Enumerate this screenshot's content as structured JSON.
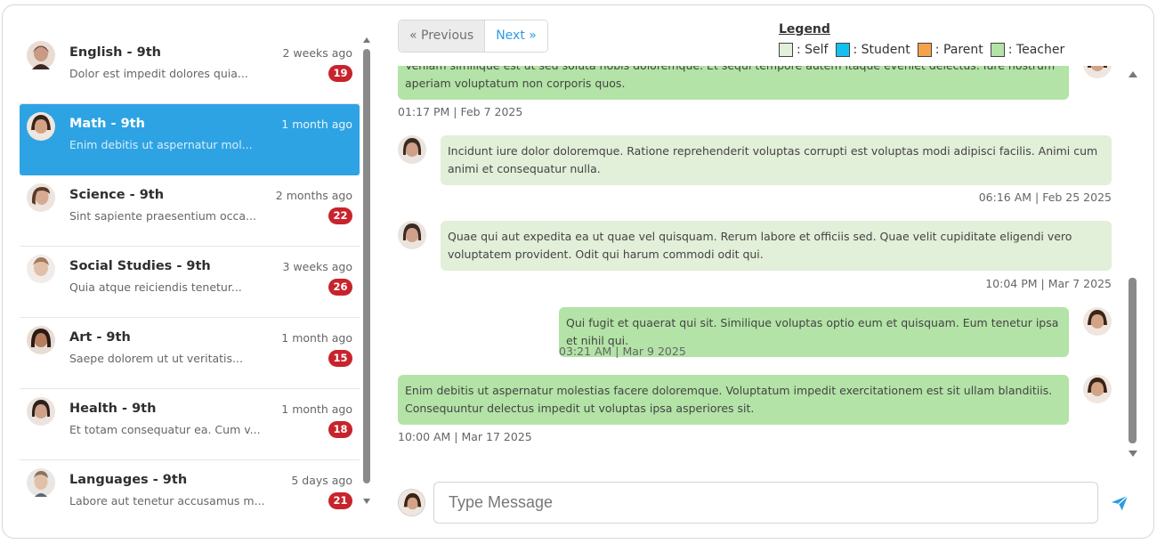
{
  "conversations": [
    {
      "title": "English - 9th",
      "preview": "Dolor est impedit dolores quia...",
      "time": "2 weeks ago",
      "badge": "19",
      "active": false
    },
    {
      "title": "Math - 9th",
      "preview": "Enim debitis ut aspernatur mol...",
      "time": "1 month ago",
      "badge": "",
      "active": true
    },
    {
      "title": "Science - 9th",
      "preview": "Sint sapiente praesentium occa...",
      "time": "2 months ago",
      "badge": "22",
      "active": false
    },
    {
      "title": "Social Studies - 9th",
      "preview": "Quia atque reiciendis tenetur...",
      "time": "3 weeks ago",
      "badge": "26",
      "active": false
    },
    {
      "title": "Art - 9th",
      "preview": "Saepe dolorem ut ut veritatis...",
      "time": "1 month ago",
      "badge": "15",
      "active": false
    },
    {
      "title": "Health - 9th",
      "preview": "Et totam consequatur ea. Cum v...",
      "time": "1 month ago",
      "badge": "18",
      "active": false
    },
    {
      "title": "Languages - 9th",
      "preview": "Labore aut tenetur accusamus m...",
      "time": "5 days ago",
      "badge": "21",
      "active": false
    }
  ],
  "pager": {
    "previous": "« Previous",
    "next": "Next »"
  },
  "legend": {
    "title": "Legend",
    "items": [
      {
        "label": ": Self",
        "color": "#e2efd9"
      },
      {
        "label": ": Student",
        "color": "#14c0ee"
      },
      {
        "label": ": Parent",
        "color": "#f5a34a"
      },
      {
        "label": ": Teacher",
        "color": "#b3e3a6"
      }
    ]
  },
  "messages": [
    {
      "text": "Veniam similique est ut sed soluta nobis doloremque. Et sequi tempore autem itaque eveniet delectus. Iure nostrum aperiam voluptatum non corporis quos.",
      "time": "01:17 PM | Feb 7 2025",
      "role": "teacher"
    },
    {
      "text": "Incidunt iure dolor doloremque. Ratione reprehenderit voluptas corrupti est voluptas modi adipisci facilis. Animi cum animi et consequatur nulla.",
      "time": "06:16 AM | Feb 25 2025",
      "role": "self"
    },
    {
      "text": "Quae qui aut expedita ea ut quae vel quisquam. Rerum labore et officiis sed. Quae velit cupiditate eligendi vero voluptatem provident. Odit qui harum commodi odit qui.",
      "time": "10:04 PM | Mar 7 2025",
      "role": "self"
    },
    {
      "text": "Qui fugit et quaerat qui sit. Similique voluptas optio eum et quisquam. Eum tenetur ipsa et nihil qui.",
      "time": "03:21 AM | Mar 9 2025",
      "role": "teacher"
    },
    {
      "text": "Enim debitis ut aspernatur molestias facere doloremque. Voluptatum impedit exercitationem est sit ullam blanditiis. Consequuntur delectus impedit ut voluptas ipsa asperiores sit.",
      "time": "10:00 AM | Mar 17 2025",
      "role": "teacher"
    }
  ],
  "composer": {
    "placeholder": "Type Message"
  },
  "icons": {
    "send": "send-icon",
    "avatar": "person-avatar-icon"
  },
  "colors": {
    "accent": "#2ea3e3",
    "badge": "#c8232c",
    "teacher_bubble": "#b3e3a6",
    "self_bubble": "#e2efd9"
  }
}
